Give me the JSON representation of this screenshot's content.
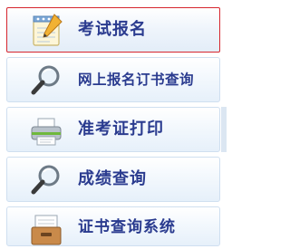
{
  "menu": {
    "items": [
      {
        "label": "考试报名",
        "icon": "notepad-pencil-icon",
        "active": true
      },
      {
        "label": "网上报名订书查询",
        "icon": "magnifier-icon",
        "active": false
      },
      {
        "label": "准考证打印",
        "icon": "printer-icon",
        "active": false
      },
      {
        "label": "成绩查询",
        "icon": "magnifier-icon",
        "active": false
      },
      {
        "label": "证书查询系统",
        "icon": "file-drawer-icon",
        "active": false
      }
    ]
  },
  "colors": {
    "label": "#2a3b8f",
    "active_border": "#d6262e",
    "item_border": "#cfdff0"
  }
}
